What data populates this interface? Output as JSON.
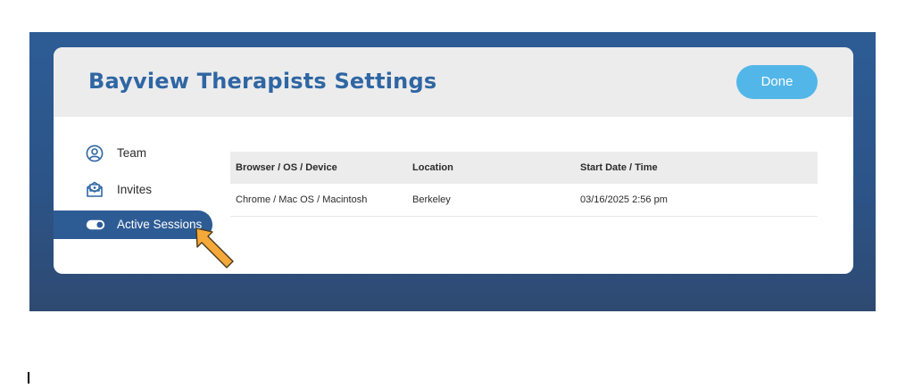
{
  "header": {
    "title": "Bayview Therapists Settings",
    "done_label": "Done"
  },
  "sidebar": {
    "items": [
      {
        "label": "Team",
        "icon": "user-circle-icon",
        "active": false
      },
      {
        "label": "Invites",
        "icon": "envelope-open-icon",
        "active": false
      },
      {
        "label": "Active Sessions",
        "icon": "toggle-icon",
        "active": true
      }
    ]
  },
  "sessions": {
    "headers": [
      "Browser / OS / Device",
      "Location",
      "Start Date / Time"
    ],
    "rows": [
      [
        "Chrome / Mac OS / Macintosh",
        "Berkeley",
        "03/16/2025 2:56 pm"
      ]
    ]
  },
  "colors": {
    "backdrop": "#2d5c95",
    "title": "#2f66a3",
    "done_button": "#52b6e8",
    "active_nav": "#2d5c95",
    "arrow_fill": "#f4a93a"
  }
}
